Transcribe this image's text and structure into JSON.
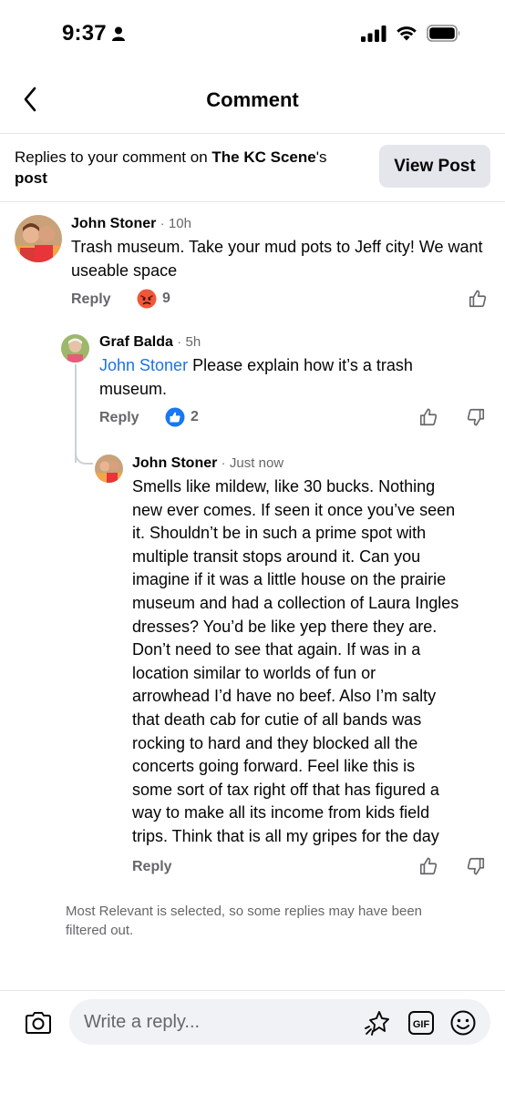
{
  "status": {
    "time": "9:37"
  },
  "nav": {
    "title": "Comment"
  },
  "banner": {
    "prefix": "Replies to your comment on ",
    "page_name": "The KC Scene",
    "suffix": "'s",
    "last_word": "post",
    "button": "View Post"
  },
  "comments": [
    {
      "author": "John Stoner",
      "separator": "·",
      "time": "10h",
      "text": "Trash museum. Take your mud pots to Jeff city!  We want useable space",
      "reply_label": "Reply",
      "reaction": "angry",
      "reaction_count": "9"
    },
    {
      "author": "Graf Balda",
      "separator": "·",
      "time": "5h",
      "mention": "John Stoner",
      "text": " Please explain how it’s a trash museum.",
      "reply_label": "Reply",
      "reaction": "like",
      "reaction_count": "2"
    },
    {
      "author": "John Stoner",
      "separator": "·",
      "time": "Just now",
      "lines": [
        "Smells like mildew, like 30 bucks. Nothing",
        "new ever comes.  If seen it once you’ve seen",
        "it. Shouldn’t be in such a prime spot with",
        "multiple transit stops around it. Can you",
        "imagine if it was a little house on the prairie",
        "museum and had a collection of Laura Ingles",
        "dresses?  You’d be like yep there they are.",
        "Don’t need to see that again.  If was in a",
        "location similar to worlds of fun or",
        "arrowhead I’d have no beef.  Also I’m salty",
        "that death cab for cutie of all bands was",
        "rocking to hard and they blocked all the",
        "concerts going forward. Feel like this is",
        "some sort of tax right off that has figured a",
        "way to make all its income from kids field",
        "trips. Think that is all my gripes for the day"
      ],
      "reply_label": "Reply"
    }
  ],
  "filter_note": "Most Relevant is selected, so some replies may have been filtered out.",
  "composer": {
    "placeholder": "Write a reply...",
    "gif_label": "GIF"
  },
  "colors": {
    "link": "#1b74e4",
    "secondary": "#65676b",
    "button_bg": "#e4e6eb",
    "angry": "#f0573a",
    "like": "#1877f2"
  }
}
